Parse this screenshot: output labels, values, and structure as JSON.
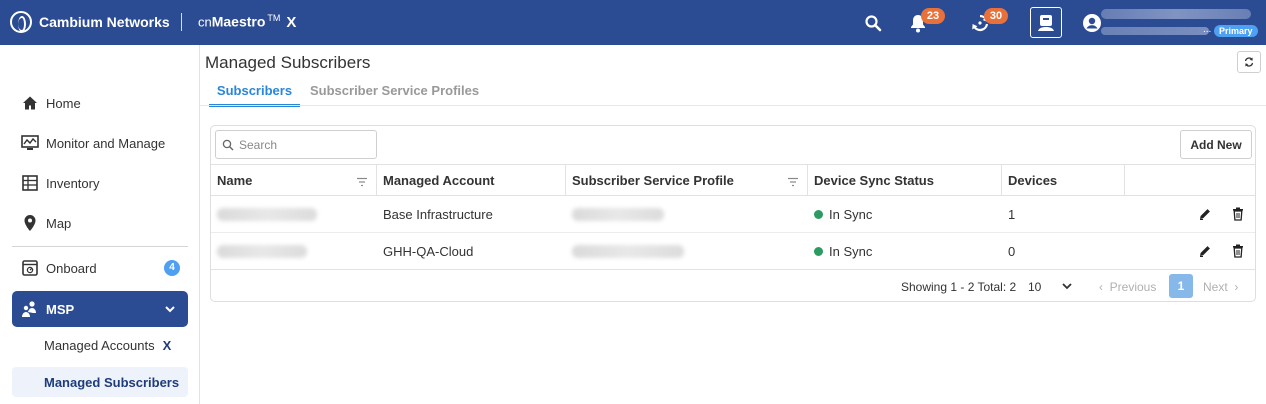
{
  "header": {
    "brand": "Cambium Networks",
    "product_prefix": "cn",
    "product_name": "Maestro",
    "product_tm": "TM",
    "product_suffix": "X",
    "notifications_count": "23",
    "sync_count": "30",
    "account_dots": "...",
    "account_role": "Primary"
  },
  "sidebar": {
    "items": [
      {
        "label": "Home",
        "icon": "home-icon"
      },
      {
        "label": "Monitor and Manage",
        "icon": "monitor-icon"
      },
      {
        "label": "Inventory",
        "icon": "inventory-icon"
      },
      {
        "label": "Map",
        "icon": "map-pin-icon"
      },
      {
        "label": "Onboard",
        "icon": "onboard-icon",
        "badge": "4"
      },
      {
        "label": "MSP",
        "icon": "msp-icon"
      }
    ],
    "msp_children": [
      {
        "label": "Managed Accounts",
        "suffix": "X"
      },
      {
        "label": "Managed Subscribers"
      }
    ]
  },
  "main": {
    "title": "Managed Subscribers",
    "tabs": [
      {
        "label": "Subscribers",
        "active": true
      },
      {
        "label": "Subscriber Service Profiles",
        "active": false
      }
    ],
    "search_placeholder": "Search",
    "add_new_label": "Add New",
    "columns": [
      "Name",
      "Managed Account",
      "Subscriber Service Profile",
      "Device Sync Status",
      "Devices"
    ],
    "rows": [
      {
        "account": "Base Infrastructure",
        "sync_status": "In Sync",
        "devices": "1"
      },
      {
        "account": "GHH-QA-Cloud",
        "sync_status": "In Sync",
        "devices": "0"
      }
    ],
    "pagination": {
      "showing": "Showing 1 - 2 Total: 2",
      "page_size": "10",
      "previous": "Previous",
      "current_page": "1",
      "next": "Next"
    }
  },
  "colors": {
    "header_bg": "#2b4c93",
    "accent": "#2a86d9",
    "badge_orange": "#e8703a",
    "in_sync_green": "#2d9a62"
  }
}
